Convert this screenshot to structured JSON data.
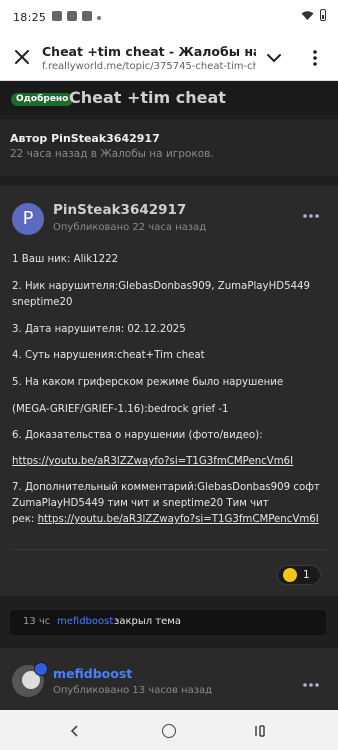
{
  "statusbar": {
    "time": "18:25"
  },
  "browser": {
    "page_title": "Cheat +tim cheat - Жалобы на игроков",
    "url": "f.reallyworld.me/topic/375745-cheat-tim-ch"
  },
  "thread": {
    "status_badge": "Одобрено",
    "title": "Cheat +tim cheat",
    "author_line": "Автор PinSteak3642917",
    "meta": "22 часа назад в Жалобы на игроков."
  },
  "post": {
    "avatar_letter": "P",
    "author": "PinSteak3642917",
    "posted": "Опубликовано 22 часа назад",
    "lines": [
      "1 Ваш ник: Alik1222",
      "2. Ник  нарушителя:GlebasDonbas909, ZumaPlayHD5449",
      "sneptime20",
      "3. Дата нарушителя: 02.12.2025",
      "4. Суть нарушения:cheat+Tim cheat",
      "5. На каком гриферском режиме было нарушение",
      "(MEGA-GRIEF/GRIEF-1.16):bedrock grief -1",
      "6. Доказательства о нарушении (фото/видео):",
      "7. Дополнительный комментарий:GlebasDonbas909 софт",
      "ZumaPlayHD5449 тим чит и sneptime20 Тим чит",
      "рек: "
    ],
    "link1": "https://youtu.be/aR3lZZwayfo?si=T1G3fmCMPencVm6I",
    "link2": "https://youtu.be/aR3lZZwayfo?si=T1G3fmCMPencVm6I",
    "reaction_count": "1"
  },
  "event": {
    "time": "13 чс",
    "user": "mefidboost",
    "action": "закрыл тема"
  },
  "post2": {
    "author": "mefidboost",
    "posted": "Опубликовано 13 часов назад"
  },
  "icons": {
    "close": "close-icon",
    "chevron": "chevron-down-icon",
    "menu": "more-vertical-icon",
    "ellipsis": "more-horizontal-icon",
    "back": "back-icon",
    "home": "home-icon",
    "recent": "recent-apps-icon"
  }
}
